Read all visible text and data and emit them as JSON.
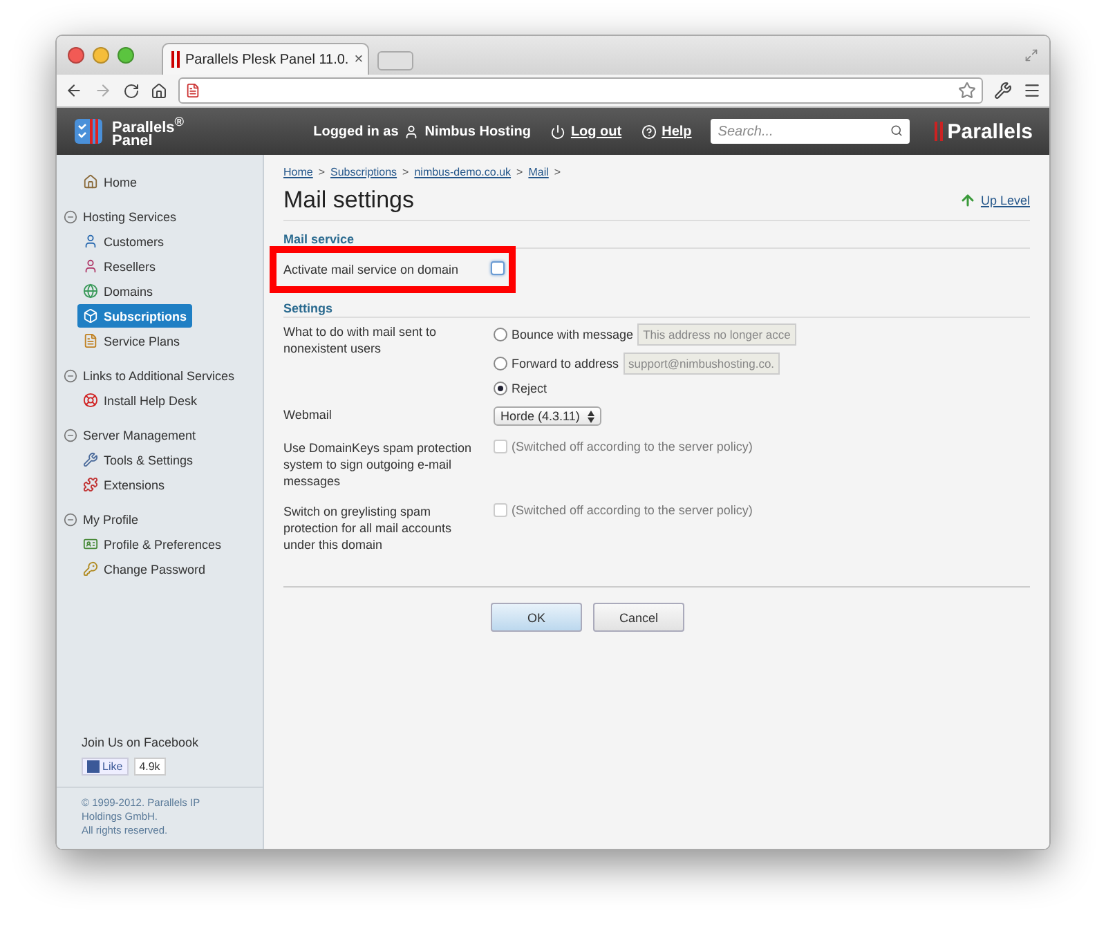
{
  "browser": {
    "tab_title": "Parallels Plesk Panel 11.0.",
    "tab_close": "×"
  },
  "header": {
    "logo_text": "Parallels$^{®}$",
    "logo_sub": "Panel",
    "logged_in_label": "Logged in as",
    "user": "Nimbus Hosting",
    "logout": "Log out",
    "help": "Help",
    "search_placeholder": "Search...",
    "brand": "Parallels"
  },
  "sidebar": {
    "items": [
      {
        "kind": "link",
        "label": "Home",
        "selected": false
      },
      {
        "kind": "group",
        "label": "Hosting Services",
        "expanded": true,
        "children": [
          {
            "label": "Customers",
            "selected": false
          },
          {
            "label": "Resellers",
            "selected": false
          },
          {
            "label": "Domains",
            "selected": false
          },
          {
            "label": "Subscriptions",
            "selected": true
          },
          {
            "label": "Service Plans",
            "selected": false
          }
        ]
      },
      {
        "kind": "group",
        "label": "Links to Additional Services",
        "expanded": true,
        "children": [
          {
            "label": "Install Help Desk",
            "selected": false
          }
        ]
      },
      {
        "kind": "group",
        "label": "Server Management",
        "expanded": true,
        "children": [
          {
            "label": "Tools & Settings",
            "selected": false
          },
          {
            "label": "Extensions",
            "selected": false
          }
        ]
      },
      {
        "kind": "group",
        "label": "My Profile",
        "expanded": true,
        "children": [
          {
            "label": "Profile & Preferences",
            "selected": false
          },
          {
            "label": "Change Password",
            "selected": false
          }
        ]
      }
    ],
    "facebook_title": "Join Us on Facebook",
    "like": "Like",
    "like_count": "4.9k",
    "copyright": [
      "© 1999-2012. Parallels IP Holdings GmbH.",
      "All rights reserved."
    ]
  },
  "breadcrumbs": [
    {
      "label": "Home",
      "separator": ">"
    },
    {
      "label": "Subscriptions",
      "separator": ">"
    },
    {
      "label": "nimbus-demo.co.uk",
      "separator": ">"
    },
    {
      "label": "Mail",
      "separator": ">"
    }
  ],
  "title": "Mail settings",
  "up_level": "Up Level",
  "mail_service": {
    "heading": "Mail service",
    "label": "Activate mail service on domain",
    "checked": false,
    "highlighted": true
  },
  "settings": {
    "heading": "Settings",
    "nonexistent": {
      "label": "What to do with mail sent to nonexistent users",
      "options": [
        {
          "label": "Bounce with message",
          "value": "This address no longer acce",
          "selected": false
        },
        {
          "label": "Forward to address",
          "value": "support@nimbushosting.co.",
          "selected": false
        },
        {
          "label": "Reject",
          "selected": true
        }
      ]
    },
    "webmail": {
      "label": "Webmail",
      "value": "Horde (4.3.11)"
    },
    "checks": [
      {
        "label": "Use DomainKeys spam protection system to sign outgoing e-mail messages",
        "note": "(Switched off according to the server policy)",
        "checked": false,
        "disabled": true
      },
      {
        "label": "Switch on greylisting spam protection for all mail accounts under this domain",
        "note": "(Switched off according to the server policy)",
        "checked": false,
        "disabled": true
      }
    ]
  },
  "buttons": [
    {
      "label": "OK",
      "primary": true
    },
    {
      "label": "Cancel",
      "primary": false
    }
  ]
}
